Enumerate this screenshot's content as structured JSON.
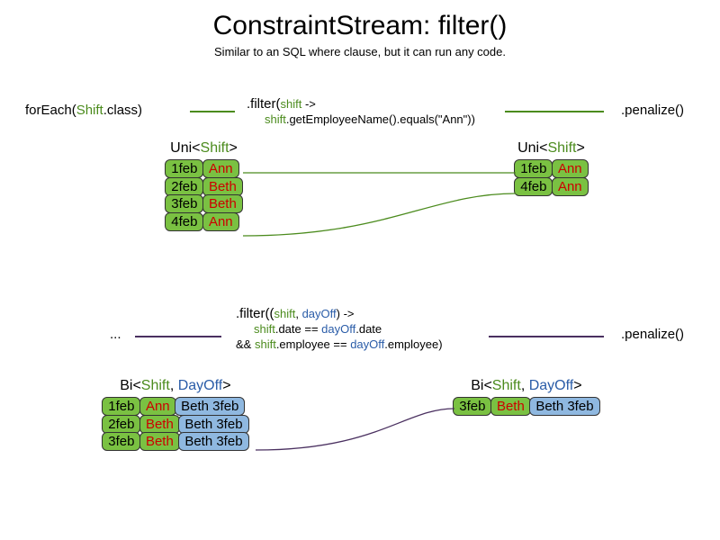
{
  "title": "ConstraintStream: filter()",
  "subtitle": "Similar to an SQL where clause, but it can run any code.",
  "chain1": {
    "forEach": {
      "method": "forEach(",
      "type": "Shift",
      "suffix": ".class)"
    },
    "filter": {
      "method": ".filter(",
      "param": "shift",
      "arrow": " ->",
      "body_param": "shift",
      "body_rest": ".getEmployeeName().equals(\"Ann\"))"
    },
    "penalize": ".penalize()"
  },
  "chain2": {
    "ellipsis": "...",
    "filter": {
      "method": ".filter((",
      "p1": "shift",
      "p2": "dayOff",
      "arrow": ") ->",
      "line2_p1": "shift",
      "line2_m1": ".date == ",
      "line2_p2": "dayOff",
      "line2_m2": ".date",
      "line3_pre": "&& ",
      "line3_p1": "shift",
      "line3_m1": ".employee == ",
      "line3_p2": "dayOff",
      "line3_m2": ".employee)"
    },
    "penalize": ".penalize()"
  },
  "uni_label": {
    "pre": "Uni<",
    "type": "Shift",
    "suf": ">"
  },
  "bi_label": {
    "pre": "Bi<",
    "t1": "Shift",
    "sep": ", ",
    "t2": "DayOff",
    "suf": ">"
  },
  "table1_left": [
    {
      "date": "1feb",
      "name": "Ann"
    },
    {
      "date": "2feb",
      "name": "Beth"
    },
    {
      "date": "3feb",
      "name": "Beth"
    },
    {
      "date": "4feb",
      "name": "Ann"
    }
  ],
  "table1_right": [
    {
      "date": "1feb",
      "name": "Ann"
    },
    {
      "date": "4feb",
      "name": "Ann"
    }
  ],
  "table2_left": [
    {
      "date": "1feb",
      "name": "Ann",
      "day": "Beth 3feb"
    },
    {
      "date": "2feb",
      "name": "Beth",
      "day": "Beth 3feb"
    },
    {
      "date": "3feb",
      "name": "Beth",
      "day": "Beth 3feb"
    }
  ],
  "table2_right": [
    {
      "date": "3feb",
      "name": "Beth",
      "day": "Beth 3feb"
    }
  ]
}
